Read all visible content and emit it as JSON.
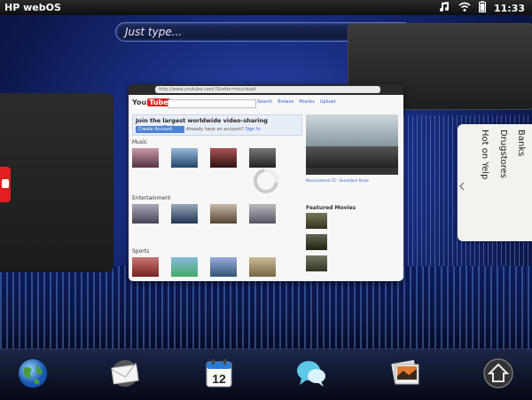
{
  "status_bar": {
    "title": "HP webOS",
    "time": "11:33",
    "icons": [
      "music-note-icon",
      "wifi-icon",
      "battery-icon"
    ]
  },
  "search": {
    "placeholder": "Just type..."
  },
  "cards": {
    "center_url": "http://www.youtube.com/?&refer=touchpad",
    "youtube": {
      "banner_title": "Join the largest worldwide video-sharing community!",
      "create_account": "Create Account",
      "already_account": "Already have an account?",
      "sign_in": "Sign In",
      "nav": [
        "Search",
        "Browse",
        "Movies",
        "Upload"
      ],
      "sections": [
        "Music",
        "Entertainment",
        "Sports"
      ],
      "featured_title": "Featured Movies",
      "video_caption": "Nosacommed 25 - Sessadore Rixxa"
    },
    "right_card_items": [
      "Banks",
      "Drugstores",
      "Hot on Yelp"
    ]
  },
  "dock": {
    "items": [
      "globe-icon",
      "email-icon",
      "calendar-icon",
      "messaging-icon",
      "photos-icon",
      "launcher-icon"
    ],
    "calendar_day": "12"
  },
  "colors": {
    "youtube_red": "#e02020",
    "accent_blue": "#4a82d8"
  }
}
